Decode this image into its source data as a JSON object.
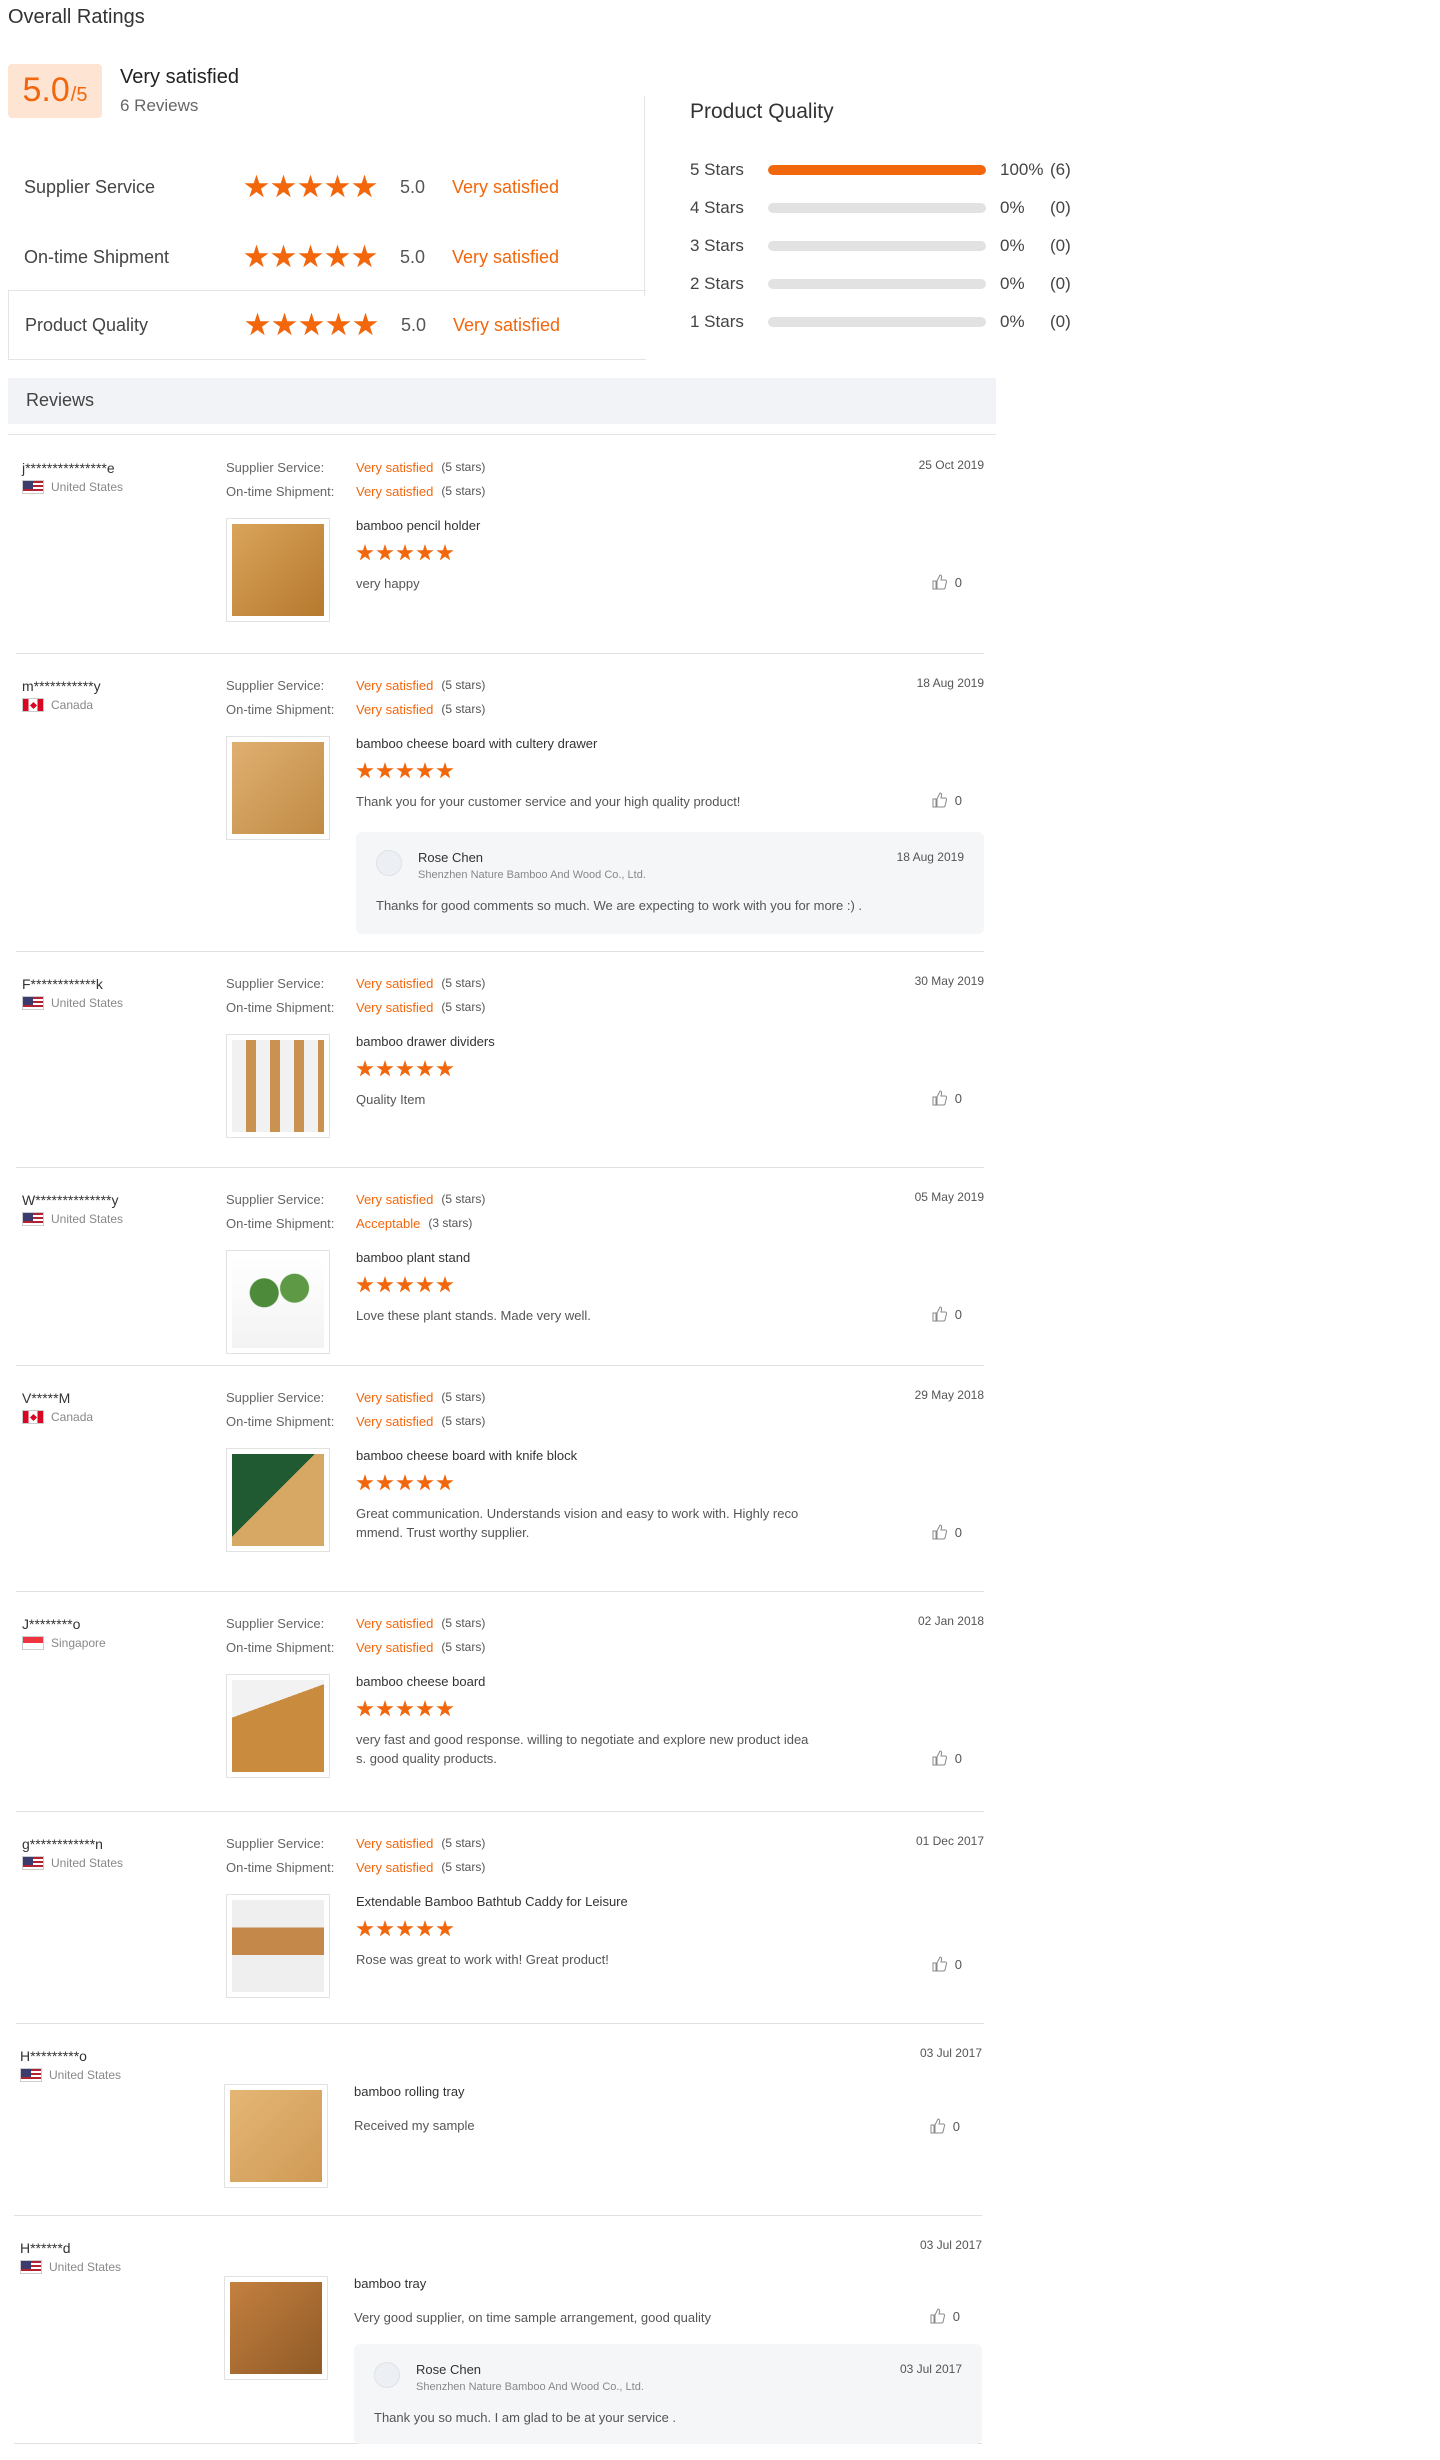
{
  "overall": {
    "title": "Overall Ratings",
    "score": "5.0",
    "score_max": "/5",
    "label": "Very satisfied",
    "count": "6 Reviews",
    "categories": [
      {
        "name": "Supplier Service",
        "score": "5.0",
        "text": "Very satisfied",
        "stars": 5
      },
      {
        "name": "On-time Shipment",
        "score": "5.0",
        "text": "Very satisfied",
        "stars": 5
      },
      {
        "name": "Product Quality",
        "score": "5.0",
        "text": "Very satisfied",
        "stars": 5
      }
    ]
  },
  "product_quality": {
    "title": "Product Quality",
    "rows": [
      {
        "label": "5 Stars",
        "pct": "100%",
        "count": "(6)",
        "fraction": 1.0
      },
      {
        "label": "4 Stars",
        "pct": "0%",
        "count": "(0)",
        "fraction": 0
      },
      {
        "label": "3 Stars",
        "pct": "0%",
        "count": "(0)",
        "fraction": 0
      },
      {
        "label": "2 Stars",
        "pct": "0%",
        "count": "(0)",
        "fraction": 0
      },
      {
        "label": "1 Stars",
        "pct": "0%",
        "count": "(0)",
        "fraction": 0
      }
    ]
  },
  "reviews_header": "Reviews",
  "labels": {
    "supplier_service": "Supplier Service:",
    "ontime_shipment": "On-time Shipment:"
  },
  "reviews": [
    {
      "user": "j***************e",
      "country": "United States",
      "flag": "us",
      "date": "25 Oct 2019",
      "service": "Very satisfied",
      "service_stars": "(5 stars)",
      "shipment": "Very satisfied",
      "shipment_stars": "(5 stars)",
      "product": "bamboo pencil holder",
      "text": "very happy",
      "likes": "0",
      "image": "img-holder"
    },
    {
      "user": "m***********y",
      "country": "Canada",
      "flag": "ca",
      "date": "18 Aug 2019",
      "service": "Very satisfied",
      "service_stars": "(5 stars)",
      "shipment": "Very satisfied",
      "shipment_stars": "(5 stars)",
      "product": "bamboo cheese board with cultery drawer",
      "text": "Thank you for your customer service and your high quality product!",
      "likes": "0",
      "image": "img-board",
      "reply": {
        "name": "Rose Chen",
        "company": "Shenzhen Nature Bamboo And Wood Co., Ltd.",
        "date": "18 Aug 2019",
        "text": "Thanks for good comments so much. We are expecting to work with you for more :) ."
      }
    },
    {
      "user": "F************k",
      "country": "United States",
      "flag": "us",
      "date": "30 May 2019",
      "service": "Very satisfied",
      "service_stars": "(5 stars)",
      "shipment": "Very satisfied",
      "shipment_stars": "(5 stars)",
      "product": "bamboo drawer dividers",
      "text": "Quality Item",
      "likes": "0",
      "image": "img-dividers"
    },
    {
      "user": "W**************y",
      "country": "United States",
      "flag": "us",
      "date": "05 May 2019",
      "service": "Very satisfied",
      "service_stars": "(5 stars)",
      "shipment": "Acceptable",
      "shipment_stars": "(3 stars)",
      "product": "bamboo plant stand",
      "text": "Love these plant stands. Made very well.",
      "likes": "0",
      "image": "img-plant"
    },
    {
      "user": "V*****M",
      "country": "Canada",
      "flag": "ca",
      "date": "29 May 2018",
      "service": "Very satisfied",
      "service_stars": "(5 stars)",
      "shipment": "Very satisfied",
      "shipment_stars": "(5 stars)",
      "product": "bamboo cheese board with knife block",
      "text_line1": "Great communication. Understands vision and easy to work with. Highly reco",
      "text_line2": "mmend. Trust worthy supplier.",
      "likes": "0",
      "image": "img-knife"
    },
    {
      "user": "J********o",
      "country": "Singapore",
      "flag": "sg",
      "date": "02 Jan 2018",
      "service": "Very satisfied",
      "service_stars": "(5 stars)",
      "shipment": "Very satisfied",
      "shipment_stars": "(5 stars)",
      "product": "bamboo cheese board",
      "text_line1": "very fast and good response. willing to negotiate and explore new product idea",
      "text_line2": "s. good quality products.",
      "likes": "0",
      "image": "img-cheese"
    },
    {
      "user": "g************n",
      "country": "United States",
      "flag": "us",
      "date": "01 Dec 2017",
      "service": "Very satisfied",
      "service_stars": "(5 stars)",
      "shipment": "Very satisfied",
      "shipment_stars": "(5 stars)",
      "product": "Extendable Bamboo Bathtub Caddy for Leisure",
      "text": "Rose was great to work with! Great product!",
      "likes": "0",
      "image": "img-caddy"
    },
    {
      "user": "H*********o",
      "country": "United States",
      "flag": "us",
      "date": "03 Jul 2017",
      "product": "bamboo rolling tray",
      "text": "Received my sample",
      "likes": "0",
      "image": "img-tray"
    },
    {
      "user": "H******d",
      "country": "United States",
      "flag": "us",
      "date": "03 Jul 2017",
      "product": "bamboo tray",
      "text": "Very good supplier, on time sample arrangement, good quality",
      "likes": "0",
      "image": "img-ttray",
      "reply": {
        "name": "Rose Chen",
        "company": "Shenzhen Nature Bamboo And Wood Co., Ltd.",
        "date": "03 Jul 2017",
        "text": "Thank you so much. I am glad to be at your service ."
      }
    }
  ]
}
